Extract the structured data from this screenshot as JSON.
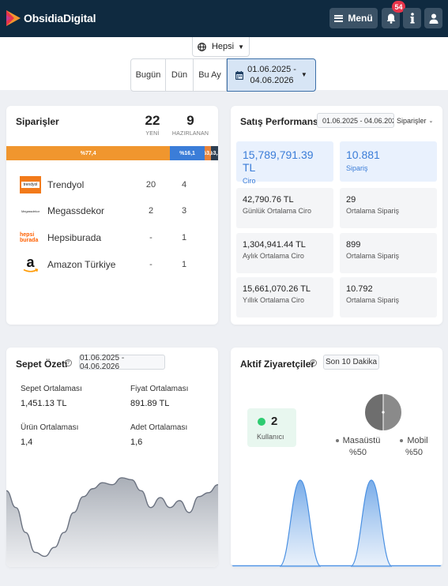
{
  "app": {
    "brand": "ObsidiaDigital"
  },
  "header": {
    "menu_label": "Menü",
    "notif_count": "54"
  },
  "filter": {
    "channel": "Hepsi",
    "today": "Bugün",
    "yesterday": "Dün",
    "this_month": "Bu Ay",
    "range_line1": "01.06.2025 -",
    "range_line2": "04.06.2026"
  },
  "orders": {
    "title": "Siparişler",
    "new_count": "22",
    "new_label": "YENİ",
    "preparing_count": "9",
    "preparing_label": "HAZIRLANAN",
    "segments": [
      {
        "label": "%77,4",
        "value": 77.4,
        "color": "#f0962e"
      },
      {
        "label": "%16,1",
        "value": 16.1,
        "color": "#3b7dd8"
      },
      {
        "label": "%3,2",
        "value": 3.2,
        "color": "#e8833a"
      },
      {
        "label": "%3,2",
        "value": 3.2,
        "color": "#2d3f52"
      }
    ],
    "marketplaces": [
      {
        "name": "Trendyol",
        "new": "20",
        "preparing": "4",
        "logo_text": "trendyol"
      },
      {
        "name": "Megassdekor",
        "new": "2",
        "preparing": "3",
        "logo_text": "Megassdekor"
      },
      {
        "name": "Hepsiburada",
        "new": "-",
        "preparing": "1",
        "logo_text_1": "hepsi",
        "logo_text_2": "burada"
      },
      {
        "name": "Amazon Türkiye",
        "new": "-",
        "preparing": "1",
        "logo_text": "a"
      }
    ]
  },
  "performance": {
    "title": "Satış Performansı",
    "range": "01.06.2025 - 04.06.2026",
    "metric_select": "Siparişler",
    "tiles": [
      {
        "value": "15,789,791.39 TL",
        "label": "Ciro"
      },
      {
        "value": "10.881",
        "label": "Sipariş"
      },
      {
        "value": "42,790.76 TL",
        "label": "Günlük Ortalama Ciro"
      },
      {
        "value": "29",
        "label": "Ortalama Sipariş"
      },
      {
        "value": "1,304,941.44 TL",
        "label": "Aylık Ortalama Ciro"
      },
      {
        "value": "899",
        "label": "Ortalama Sipariş"
      },
      {
        "value": "15,661,070.26 TL",
        "label": "Yıllık Ortalama Ciro"
      },
      {
        "value": "10.792",
        "label": "Ortalama Sipariş"
      }
    ]
  },
  "basket": {
    "title": "Sepet Özeti",
    "range": "01.06.2025 - 04.06.2026",
    "avg_basket_label": "Sepet Ortalaması",
    "avg_basket_value": "1,451.13 TL",
    "avg_price_label": "Fiyat Ortalaması",
    "avg_price_value": "891.89 TL",
    "avg_product_label": "Ürün Ortalaması",
    "avg_product_value": "1,4",
    "avg_qty_label": "Adet Ortalaması",
    "avg_qty_value": "1,6",
    "trend": [
      0.72,
      0.55,
      0.3,
      0.1,
      0.06,
      0.15,
      0.3,
      0.5,
      0.66,
      0.74,
      0.8,
      0.78,
      0.85,
      0.83,
      0.72,
      0.55,
      0.65,
      0.55,
      0.62,
      0.5,
      0.66,
      0.7,
      0.78
    ]
  },
  "visitors": {
    "title": "Aktif Ziyaretçiler",
    "window": "Son 10 Dakika",
    "users_count": "2",
    "users_label": "Kullanıcı",
    "desktop_label": "Masaüstü",
    "desktop_pct": "%50",
    "mobile_label": "Mobil",
    "mobile_pct": "%50",
    "desktop_share": 50,
    "mobile_share": 50,
    "pie_colors": [
      "#8a8a8a",
      "#6e6e6e"
    ]
  },
  "colors": {
    "header_bg": "#0f2a40",
    "accent_blue": "#3b7dd8",
    "badge_red": "#e8344a"
  }
}
